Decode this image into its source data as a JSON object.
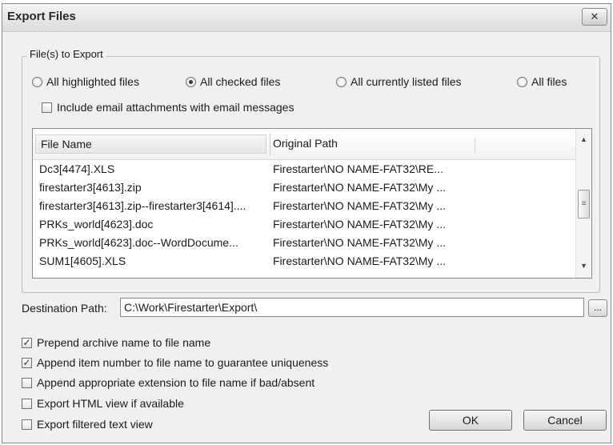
{
  "window": {
    "title": "Export Files",
    "close_label": "✕"
  },
  "export_group": {
    "legend": "File(s) to Export",
    "options": [
      {
        "label": "All highlighted files",
        "selected": false
      },
      {
        "label": "All checked files",
        "selected": true
      },
      {
        "label": "All currently listed files",
        "selected": false
      },
      {
        "label": "All files",
        "selected": false
      }
    ],
    "include_attachments": {
      "label": "Include email attachments with email messages",
      "checked": false
    }
  },
  "file_list": {
    "columns": [
      "File Name",
      "Original Path"
    ],
    "rows": [
      {
        "name": "Dc3[4474].XLS",
        "path": "Firestarter\\NO NAME-FAT32\\RE..."
      },
      {
        "name": "firestarter3[4613].zip",
        "path": "Firestarter\\NO NAME-FAT32\\My ..."
      },
      {
        "name": "firestarter3[4613].zip--firestarter3[4614]....",
        "path": "Firestarter\\NO NAME-FAT32\\My ..."
      },
      {
        "name": "PRKs_world[4623].doc",
        "path": "Firestarter\\NO NAME-FAT32\\My ..."
      },
      {
        "name": "PRKs_world[4623].doc--WordDocume...",
        "path": "Firestarter\\NO NAME-FAT32\\My ..."
      },
      {
        "name": "SUM1[4605].XLS",
        "path": "Firestarter\\NO NAME-FAT32\\My ..."
      }
    ]
  },
  "destination": {
    "label": "Destination Path:",
    "value": "C:\\Work\\Firestarter\\Export\\",
    "browse_label": "..."
  },
  "options": [
    {
      "label": "Prepend archive name to file name",
      "checked": true
    },
    {
      "label": "Append item number to file name to guarantee uniqueness",
      "checked": true
    },
    {
      "label": "Append appropriate extension to file name if bad/absent",
      "checked": false
    },
    {
      "label": "Export HTML view if available",
      "checked": false
    },
    {
      "label": "Export filtered text view",
      "checked": false
    }
  ],
  "buttons": {
    "ok": "OK",
    "cancel": "Cancel"
  }
}
